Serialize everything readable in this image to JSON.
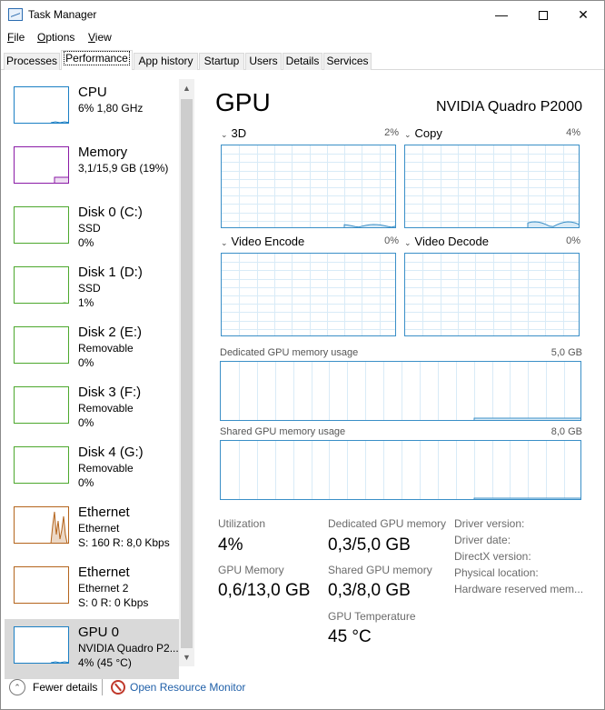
{
  "window": {
    "title": "Task Manager"
  },
  "menu": [
    {
      "label": "File",
      "u": "F",
      "rest": "ile"
    },
    {
      "label": "Options",
      "u": "O",
      "rest": "ptions"
    },
    {
      "label": "View",
      "u": "V",
      "rest": "iew"
    }
  ],
  "tabs": [
    "Processes",
    "Performance",
    "App history",
    "Startup",
    "Users",
    "Details",
    "Services"
  ],
  "active_tab": "Performance",
  "sidebar": [
    {
      "name": "CPU",
      "line1": "6% 1,80 GHz",
      "line2": "",
      "color": "#1b7fc4"
    },
    {
      "name": "Memory",
      "line1": "3,1/15,9 GB (19%)",
      "line2": "",
      "color": "#8b1aa6"
    },
    {
      "name": "Disk 0 (C:)",
      "line1": "SSD",
      "line2": "0%",
      "color": "#4ca82d"
    },
    {
      "name": "Disk 1 (D:)",
      "line1": "SSD",
      "line2": "1%",
      "color": "#4ca82d"
    },
    {
      "name": "Disk 2 (E:)",
      "line1": "Removable",
      "line2": "0%",
      "color": "#4ca82d"
    },
    {
      "name": "Disk 3 (F:)",
      "line1": "Removable",
      "line2": "0%",
      "color": "#4ca82d"
    },
    {
      "name": "Disk 4 (G:)",
      "line1": "Removable",
      "line2": "0%",
      "color": "#4ca82d"
    },
    {
      "name": "Ethernet",
      "line1": "Ethernet",
      "line2": "S: 160  R: 8,0 Kbps",
      "color": "#b4641c"
    },
    {
      "name": "Ethernet",
      "line1": "Ethernet 2",
      "line2": "S: 0  R: 0 Kbps",
      "color": "#b4641c"
    },
    {
      "name": "GPU 0",
      "line1": "NVIDIA Quadro P2...",
      "line2": "4% (45 °C)",
      "color": "#1b7fc4"
    }
  ],
  "main": {
    "title": "GPU",
    "model": "NVIDIA Quadro P2000",
    "engines": [
      {
        "label": "3D",
        "pct": "2%"
      },
      {
        "label": "Copy",
        "pct": "4%"
      },
      {
        "label": "Video Encode",
        "pct": "0%"
      },
      {
        "label": "Video Decode",
        "pct": "0%"
      }
    ],
    "dedicated_label": "Dedicated GPU memory usage",
    "dedicated_max": "5,0 GB",
    "shared_label": "Shared GPU memory usage",
    "shared_max": "8,0 GB",
    "stats": {
      "utilization_k": "Utilization",
      "utilization_v": "4%",
      "gpu_mem_k": "GPU Memory",
      "gpu_mem_v": "0,6/13,0 GB",
      "ded_mem_k": "Dedicated GPU memory",
      "ded_mem_v": "0,3/5,0 GB",
      "shr_mem_k": "Shared GPU memory",
      "shr_mem_v": "0,3/8,0 GB",
      "temp_k": "GPU Temperature",
      "temp_v": "45 °C"
    },
    "info": [
      "Driver version:",
      "Driver date:",
      "DirectX version:",
      "Physical location:",
      "Hardware reserved mem..."
    ]
  },
  "footer": {
    "fewer_details": "Fewer details",
    "fewer_u": "d",
    "open_monitor": "Open Resource Monitor"
  },
  "colors": {
    "accent": "#3a8fc7",
    "selected": "#d9d9d9"
  }
}
